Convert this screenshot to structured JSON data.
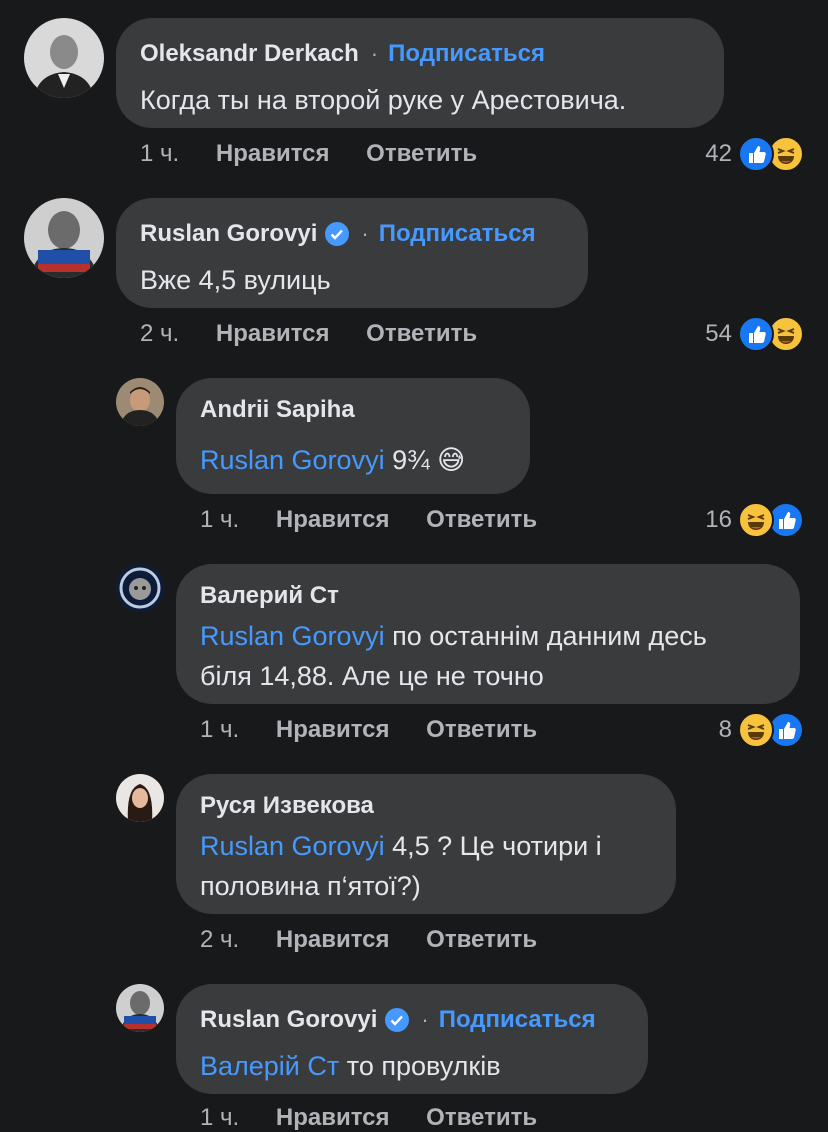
{
  "follow_label": "Подписаться",
  "like_label": "Нравится",
  "reply_label": "Ответить",
  "comments": [
    {
      "name": "Oleksandr Derkach",
      "verified": false,
      "follow": true,
      "text": "Когда ты на второй руке у Арестовича.",
      "time": "1 ч.",
      "count": "42",
      "reactions": [
        "like-icon",
        "haha-icon"
      ]
    },
    {
      "name": "Ruslan Gorovyi",
      "verified": true,
      "follow": true,
      "text": "Вже 4,5 вулиць",
      "time": "2 ч.",
      "count": "54",
      "reactions": [
        "like-icon",
        "haha-icon"
      ]
    },
    {
      "name": "Andrii Sapiha",
      "mention": "Ruslan Gorovyi",
      "text": "9¾",
      "emoji": "😅",
      "time": "1 ч.",
      "count": "16",
      "reactions": [
        "haha-icon",
        "like-icon"
      ]
    },
    {
      "name": "Валерий Ст",
      "mention": "Ruslan Gorovyi",
      "text_line1": "по останнім данним десь",
      "text_line2": "біля 14,88. Але це не точно",
      "time": "1 ч.",
      "count": "8",
      "reactions": [
        "haha-icon",
        "like-icon"
      ]
    },
    {
      "name": "Руся Извекова",
      "mention": "Ruslan Gorovyi",
      "text_line1": "4,5 ? Це чотири і",
      "text_line2": "половина п‘ятої?)",
      "time": "2 ч."
    },
    {
      "name": "Ruslan Gorovyi",
      "verified": true,
      "follow": true,
      "mention": "Валерій Ст",
      "text": "то провулків",
      "time": "1 ч."
    }
  ]
}
